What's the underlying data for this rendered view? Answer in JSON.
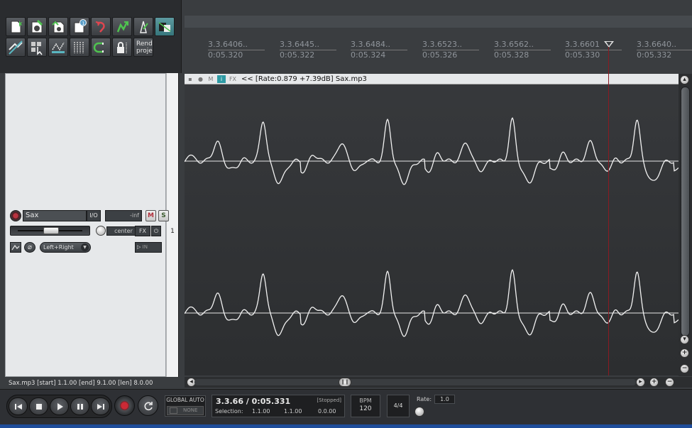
{
  "toolbar": {
    "render_label": "Rend\nproje",
    "buttons": [
      "new-project-icon",
      "open-project-icon",
      "save-project-icon",
      "project-settings-icon",
      "undo-icon",
      "redo-icon",
      "metronome-icon",
      "auto-crossfade-icon",
      "grid-icon",
      "snap-icon",
      "ripple-edit-icon",
      "envelope-points-icon",
      "loop-points-icon",
      "magnet-icon",
      "lock-icon"
    ]
  },
  "track": {
    "number": "1",
    "name": "Sax",
    "io_label": "I/O",
    "volume_readout": "-inf",
    "mute_label": "M",
    "solo_label": "S",
    "pan_label": "center",
    "fx_label": "FX",
    "fx_bypass_label": "⏻",
    "channel_mode": "Left+Right",
    "input_monitor_label": "IN",
    "volume_level": 0.5
  },
  "item_status": "Sax.mp3 [start] 1.1.00 [end] 9.1.00 [len] 8.0.00",
  "ruler": {
    "labels": [
      {
        "beats": "3.3.6406..",
        "time": "0:05.320"
      },
      {
        "beats": "3.3.6445..",
        "time": "0:05.322"
      },
      {
        "beats": "3.3.6484..",
        "time": "0:05.324"
      },
      {
        "beats": "3.3.6523..",
        "time": "0:05.326"
      },
      {
        "beats": "3.3.6562..",
        "time": "0:05.328"
      },
      {
        "beats": "3.3.6601",
        "time": "0:05.330"
      },
      {
        "beats": "3.3.6640..",
        "time": "0:05.332"
      }
    ]
  },
  "item": {
    "header_icons": [
      "lock-icon",
      "note-icon",
      "M",
      "i",
      "FX"
    ],
    "title": "<< [Rate:0.879 +7.39dB] Sax.mp3"
  },
  "transport": {
    "global_auto_label": "GLOBAL AUTO",
    "global_auto_mode": "NONE",
    "time_main": "3.3.66 / 0:05.331",
    "play_state": "[Stopped]",
    "selection_label": "Selection:",
    "selection_start": "1.1.00",
    "selection_end": "1.1.00",
    "selection_length": "0.0.00",
    "bpm_label": "BPM",
    "bpm_value": "120",
    "time_signature": "4/4",
    "rate_label": "Rate:",
    "rate_value": "1.0"
  },
  "colors": {
    "accent_teal": "#3d8b91",
    "record_red": "#cc2a36",
    "playhead": "#8b1a22"
  }
}
